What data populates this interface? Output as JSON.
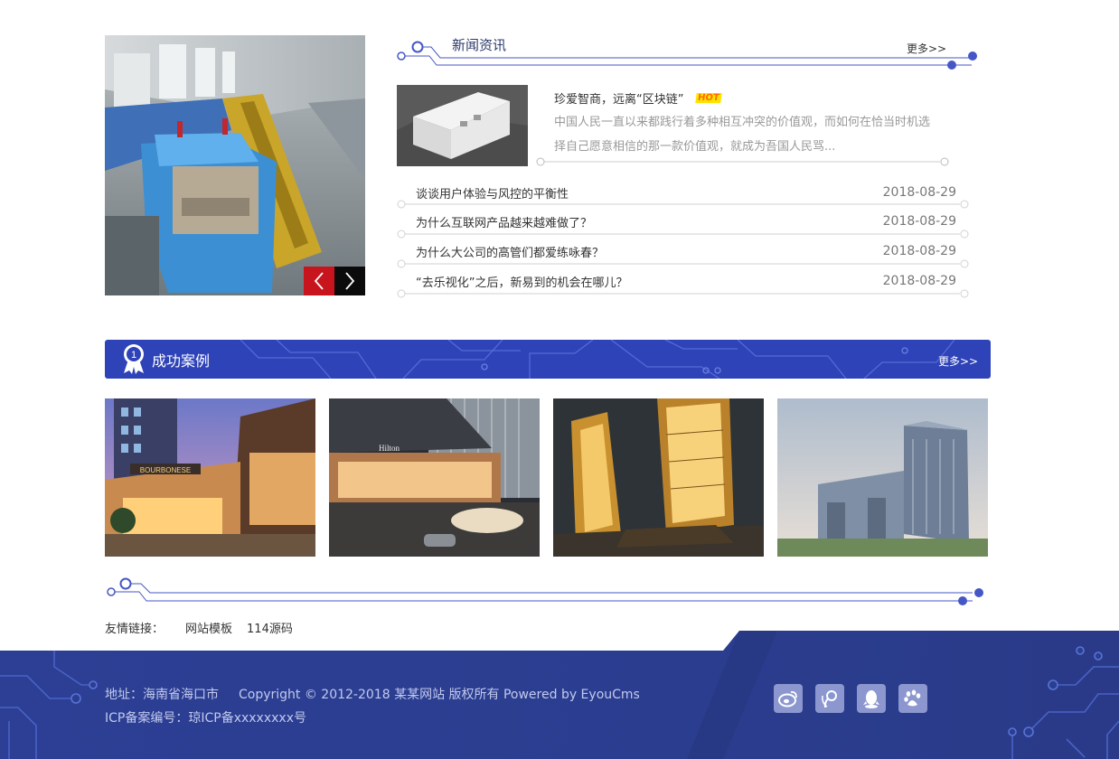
{
  "slider": {
    "prev_icon": "chevron-left-icon",
    "next_icon": "chevron-right-icon"
  },
  "news": {
    "title": "新闻资讯",
    "more": "更多>>",
    "featured": {
      "title": "珍爱智商，远离“区块链”",
      "badge": "HOT",
      "desc": "中国人民一直以来都践行着多种相互冲突的价值观，而如何在恰当时机选择自己愿意相信的那一款价值观，就成为吾国人民骂..."
    },
    "items": [
      {
        "title": "谈谈用户体验与风控的平衡性",
        "date": "2018-08-29"
      },
      {
        "title": "为什么互联网产品越来越难做了？",
        "date": "2018-08-29"
      },
      {
        "title": "为什么大公司的高管们都爱练咏春？",
        "date": "2018-08-29"
      },
      {
        "title": "“去乐视化”之后，新易到的机会在哪儿？",
        "date": "2018-08-29"
      }
    ]
  },
  "cases": {
    "badge_number": "1",
    "title": "成功案例",
    "more": "更多>>",
    "image_labels": [
      "BOURBONESE",
      "Hilton"
    ]
  },
  "links": {
    "label": "友情链接：",
    "items": [
      "网站模板",
      "114源码"
    ]
  },
  "footer": {
    "address": "地址：海南省海口市",
    "copyright": "Copyright © 2012-2018 某某网站 版权所有 Powered by EyouCms",
    "icp": "ICP备案编号：琼ICP备xxxxxxxx号",
    "social_icons": [
      "weibo-icon",
      "tencent-weibo-icon",
      "qq-icon",
      "baidu-paw-icon"
    ]
  },
  "colors": {
    "primary_blue": "#2e43b8",
    "footer_blue": "#2b3f92",
    "slider_prev_red": "#c8141c",
    "hot_badge": "#ffe400",
    "line_blue": "#4556c6"
  }
}
